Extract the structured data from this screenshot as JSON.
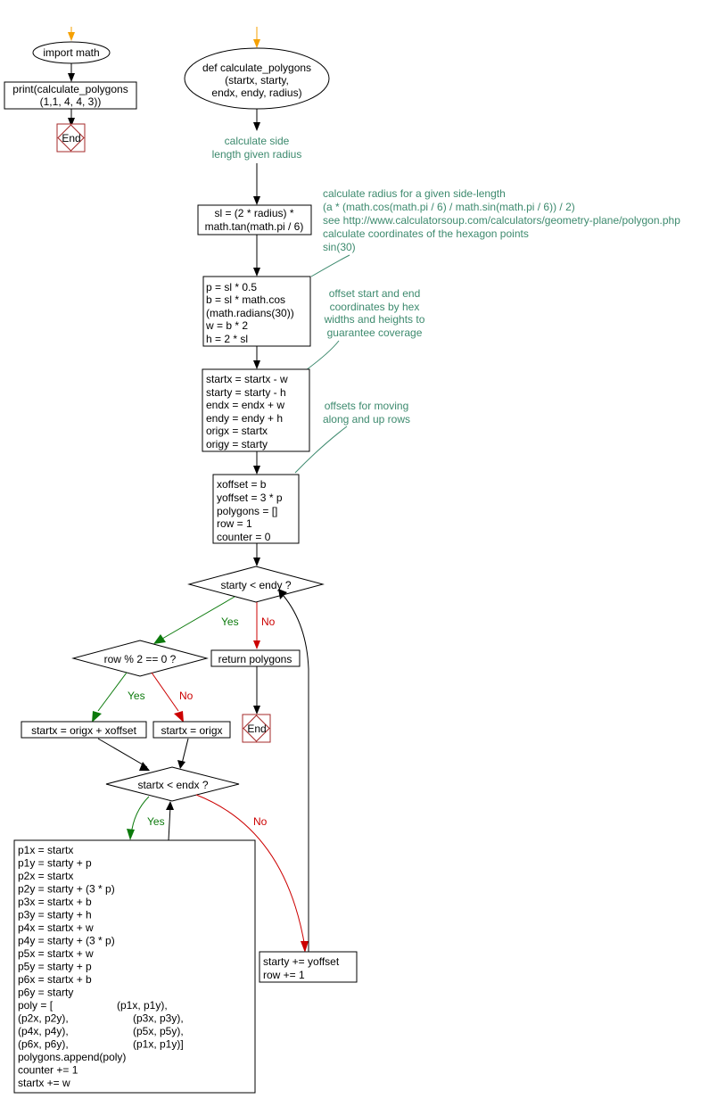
{
  "main_flow": {
    "start_node": "import math",
    "print_node": [
      "print(calculate_polygons",
      "(1,1, 4, 4, 3))"
    ],
    "end_node": "End"
  },
  "function_flow": {
    "def_node": [
      "def calculate_polygons",
      "(startx, starty,",
      "endx, endy, radius)"
    ],
    "comment_side_length": [
      "calculate side",
      "length given radius"
    ],
    "sl_node": [
      "sl = (2 * radius) *",
      "math.tan(math.pi / 6)"
    ],
    "comment_radius": [
      "calculate radius for a given side-length",
      "(a * (math.cos(math.pi / 6) / math.sin(math.pi / 6)) / 2)",
      "see http://www.calculatorsoup.com/calculators/geometry-plane/polygon.php",
      "calculate coordinates of the hexagon points",
      "sin(30)"
    ],
    "pb_node": [
      "p = sl * 0.5",
      "b = sl * math.cos",
      "(math.radians(30))",
      "w = b * 2",
      "h = 2 * sl"
    ],
    "comment_offset": [
      "offset start and end",
      "coordinates by hex",
      "widths and heights to",
      "guarantee coverage"
    ],
    "start_node": [
      "startx = startx - w",
      "starty = starty - h",
      "endx = endx + w",
      "endy = endy + h",
      "origx = startx",
      "origy = starty"
    ],
    "comment_moving": [
      "offsets for moving",
      "along and up rows"
    ],
    "init_node": [
      "xoffset = b",
      "yoffset = 3 * p",
      "polygons = []",
      "row = 1",
      "counter = 0"
    ],
    "decision_starty": "starty < endy ?",
    "decision_row": "row % 2 == 0 ?",
    "return_node": "return polygons",
    "end_node": "End",
    "startx_offset_node": "startx = origx + xoffset",
    "startx_orig_node": "startx = origx",
    "decision_startx": "startx < endx ?",
    "loop_body": [
      "p1x = startx",
      "p1y = starty + p",
      "p2x = startx",
      "p2y = starty + (3 * p)",
      "p3x = startx + b",
      "p3y = starty + h",
      "p4x = startx + w",
      "p4y = starty + (3 * p)",
      "p5x = startx + w",
      "p5y = starty + p",
      "p6x = startx + b",
      "p6y = starty",
      [
        "poly = [",
        "(p1x, p1y),"
      ],
      [
        "(p2x, p2y),",
        "(p3x, p3y),"
      ],
      [
        "(p4x, p4y),",
        "(p5x, p5y),"
      ],
      [
        "(p6x, p6y),",
        "(p1x, p1y)]"
      ],
      "polygons.append(poly)",
      "counter += 1",
      "startx += w"
    ],
    "increment_node": [
      "starty += yoffset",
      "row += 1"
    ]
  },
  "labels": {
    "yes": "Yes",
    "no": "No"
  },
  "colors": {
    "start_arrow": "#f5a000",
    "comment": "#3d8a6e",
    "yes": "#0c7a0c",
    "no": "#cc0000",
    "end_border": "#a52a2a"
  }
}
